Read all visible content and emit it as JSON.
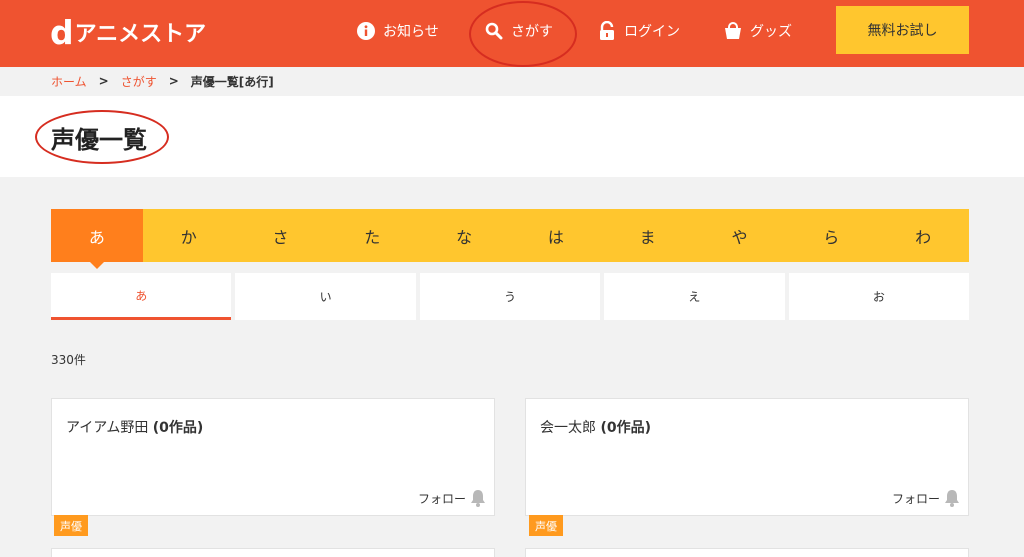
{
  "header": {
    "logo_d": "d",
    "logo_text": "アニメストア",
    "nav": [
      {
        "label": "お知らせ",
        "icon": "info-icon"
      },
      {
        "label": "さがす",
        "icon": "search-icon"
      },
      {
        "label": "ログイン",
        "icon": "lock-icon"
      },
      {
        "label": "グッズ",
        "icon": "shopping-bag-icon"
      }
    ],
    "trial_label": "無料お試し"
  },
  "breadcrumb": {
    "items": [
      "ホーム",
      "さがす"
    ],
    "separator": ">",
    "current": "声優一覧[あ行]"
  },
  "page_title": "声優一覧",
  "kana_tabs": [
    "あ",
    "か",
    "さ",
    "た",
    "な",
    "は",
    "ま",
    "や",
    "ら",
    "わ"
  ],
  "kana_active": "あ",
  "sub_tabs": [
    "あ",
    "い",
    "う",
    "え",
    "お"
  ],
  "sub_active": "あ",
  "result_count": "330件",
  "cards": [
    {
      "name": "アイアム野田",
      "works": "(0作品)",
      "follow_label": "フォロー",
      "tag": "声優"
    },
    {
      "name": "会一太郎",
      "works": "(0作品)",
      "follow_label": "フォロー",
      "tag": "声優"
    }
  ],
  "colors": {
    "brand": "#ef5330",
    "accent_yellow": "#ffc62e",
    "active_orange": "#ff7f1c",
    "tag_orange": "#ff9a1e",
    "annotation_red": "#d62d20"
  }
}
